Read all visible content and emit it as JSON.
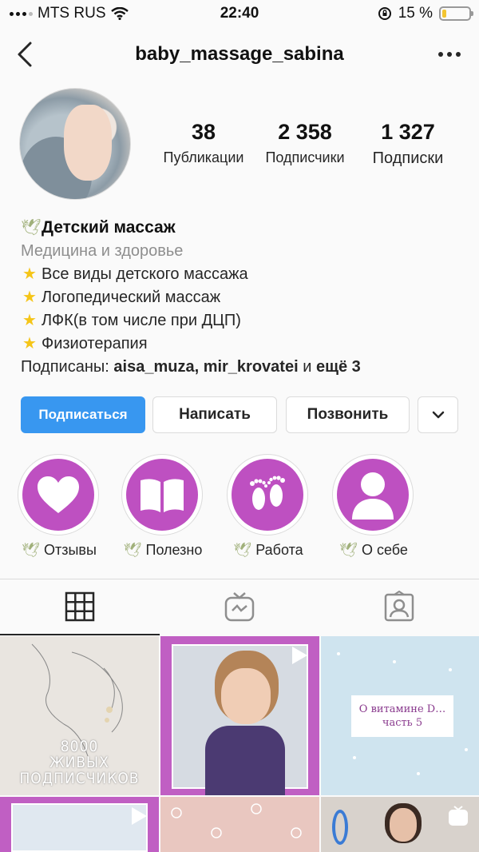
{
  "status_bar": {
    "carrier": "MTS RUS",
    "time": "22:40",
    "battery_percent": "15 %",
    "battery_level": 0.15
  },
  "nav": {
    "username": "baby_massage_sabina"
  },
  "stats": [
    {
      "value": "38",
      "label": "Публикации"
    },
    {
      "value": "2 358",
      "label": "Подписчики"
    },
    {
      "value": "1 327",
      "label": "Подписки"
    }
  ],
  "bio": {
    "name": "Детский массаж",
    "category": "Медицина и здоровье",
    "lines": [
      "Все виды детского массажа",
      "Логопедический массаж",
      "ЛФК(в том числе при ДЦП)",
      "Физиотерапия"
    ],
    "followed_by_prefix": "Подписаны: ",
    "followed_by_user1": "aisa_muza",
    "followed_by_sep": ", ",
    "followed_by_user2": "mir_krovatei",
    "followed_by_suffix": " и ",
    "followed_by_more": "ещё 3"
  },
  "buttons": {
    "follow": "Подписаться",
    "message": "Написать",
    "call": "Позвонить"
  },
  "highlights": [
    {
      "label": "Отзывы",
      "icon": "heart-icon"
    },
    {
      "label": "Полезно",
      "icon": "book-icon"
    },
    {
      "label": "Работа",
      "icon": "footprints-icon"
    },
    {
      "label": "О себе",
      "icon": "person-icon"
    }
  ],
  "tabs": [
    "grid-icon",
    "igtv-icon",
    "tagged-icon"
  ],
  "posts": {
    "post1_text": "8000\nЖИВЫХ\nПОДПИСЧИКОВ",
    "post3_text": "О витамине D…\nчасть 5"
  },
  "colors": {
    "accent": "#3897f0",
    "highlight": "#be50c1",
    "battery": "#f3c530"
  }
}
